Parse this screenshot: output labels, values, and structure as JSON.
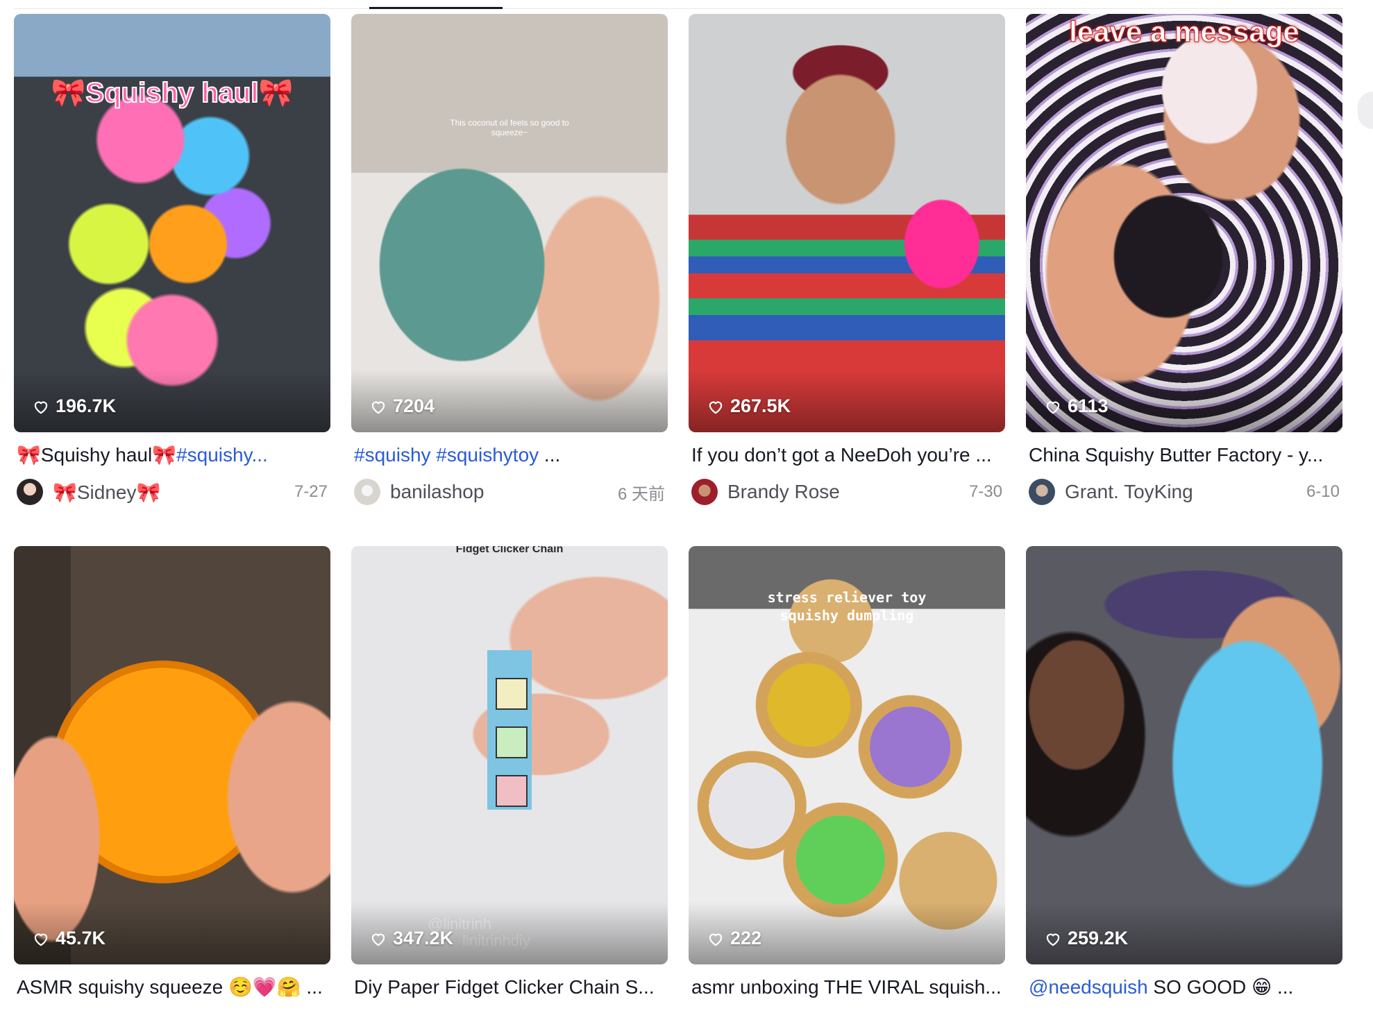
{
  "videos": [
    {
      "likes": "196.7K",
      "overlay": "🎀Squishy haul🎀",
      "caption_prefix": "🎀Squishy haul🎀",
      "caption_tag": "#squishy...",
      "caption_rest": "",
      "author": "🎀Sidney🎀",
      "date": "7-27"
    },
    {
      "likes": "7204",
      "overlay": "This coconut oil feels so good to squeeze~",
      "caption_prefix": "",
      "caption_tag": "#squishy #squishytoy",
      "caption_rest": " ...",
      "author": "banilashop",
      "date": "6 天前"
    },
    {
      "likes": "267.5K",
      "overlay": "",
      "caption_prefix": "If you don’t got a NeeDoh you’re ...",
      "caption_tag": "",
      "caption_rest": "",
      "author": "Brandy Rose",
      "date": "7-30"
    },
    {
      "likes": "6113",
      "overlay": "leave a message",
      "caption_prefix": "China Squishy Butter Factory - y...",
      "caption_tag": "",
      "caption_rest": "",
      "author": "Grant. ToyKing",
      "date": "6-10"
    },
    {
      "likes": "45.7K",
      "overlay": "",
      "caption_prefix": "ASMR squishy squeeze ☺️💗🤗 ...",
      "caption_tag": "",
      "caption_rest": "",
      "author": "",
      "date": ""
    },
    {
      "likes": "347.2K",
      "overlay": "Fidget Clicker Chain",
      "watermark": "@linitrinh",
      "watermark2": "linitrinhdiy",
      "caption_prefix": "Diy Paper Fidget Clicker Chain S...",
      "caption_tag": "",
      "caption_rest": "",
      "author": "",
      "date": ""
    },
    {
      "likes": "222",
      "overlay": "stress reliever toy",
      "overlay2": "squishy dumpling",
      "caption_prefix": "asmr unboxing THE VIRAL squish...",
      "caption_tag": "",
      "caption_rest": "",
      "author": "",
      "date": ""
    },
    {
      "likes": "259.2K",
      "overlay": "",
      "caption_prefix": "",
      "caption_tag": "@needsquish",
      "caption_rest": " SO GOOD 😁 ...",
      "author": "",
      "date": ""
    }
  ],
  "colors": {
    "text_primary": "#161823",
    "hashtag": "#2b5bd7",
    "meta": "#8a8b91"
  },
  "icons": {
    "likes": "heart-outline-icon"
  }
}
